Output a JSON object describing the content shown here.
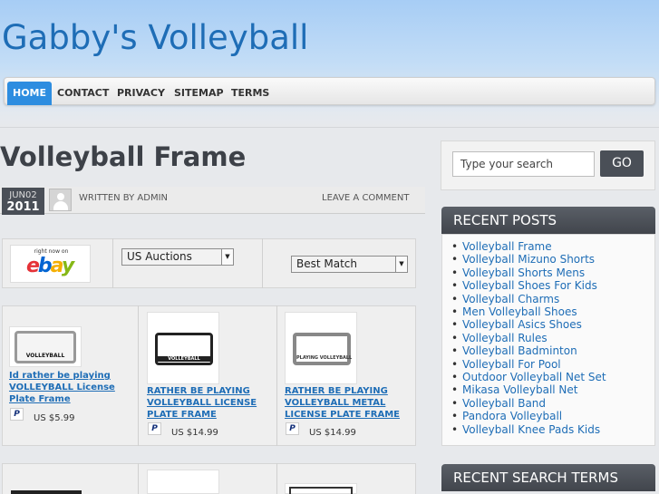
{
  "site": {
    "title": "Gabby's Volleyball"
  },
  "nav": {
    "items": [
      "HOME",
      "CONTACT",
      "PRIVACY",
      "SITEMAP",
      "TERMS"
    ]
  },
  "post": {
    "title": "Volleyball Frame",
    "date_month": "JUN02",
    "date_year": "2011",
    "written_by": "WRITTEN BY ADMIN",
    "leave_comment": "LEAVE A COMMENT"
  },
  "auctions": {
    "ebay_tagline": "right now on",
    "ebay_logo_text": "ebay",
    "source_select": "US Auctions",
    "sort_select": "Best Match"
  },
  "products": [
    {
      "title": "Id rather be playing VOLLEYBALL License Plate Frame",
      "price": "US $5.99",
      "plate_text": "VOLLEYBALL"
    },
    {
      "title": "RATHER BE PLAYING VOLLEYBALL LICENSE PLATE FRAME",
      "price": "US $14.99",
      "plate_text": "VOLLEYBALL"
    },
    {
      "title": "RATHER BE PLAYING VOLLEYBALL METAL LICENSE PLATE FRAME",
      "price": "US $14.99",
      "plate_text": "PLAYING VOLLEYBALL"
    }
  ],
  "sidebar": {
    "search_placeholder": "Type your search",
    "search_button": "GO",
    "recent_posts_title": "RECENT POSTS",
    "recent_posts": [
      "Volleyball Frame",
      "Volleyball Mizuno Shorts",
      "Volleyball Shorts Mens",
      "Volleyball Shoes For Kids",
      "Volleyball Charms",
      "Men Volleyball Shoes",
      "Volleyball Asics Shoes",
      "Volleyball Rules",
      "Volleyball Badminton",
      "Volleyball For Pool",
      "Outdoor Volleyball Net Set",
      "Mikasa Volleyball Net",
      "Volleyball Band",
      "Pandora Volleyball",
      "Volleyball Knee Pads Kids"
    ],
    "recent_search_title": "RECENT SEARCH TERMS"
  },
  "colors": {
    "link": "#1e6db6",
    "nav_active": "#2d8de0",
    "widget_header": "#4a4f57"
  }
}
